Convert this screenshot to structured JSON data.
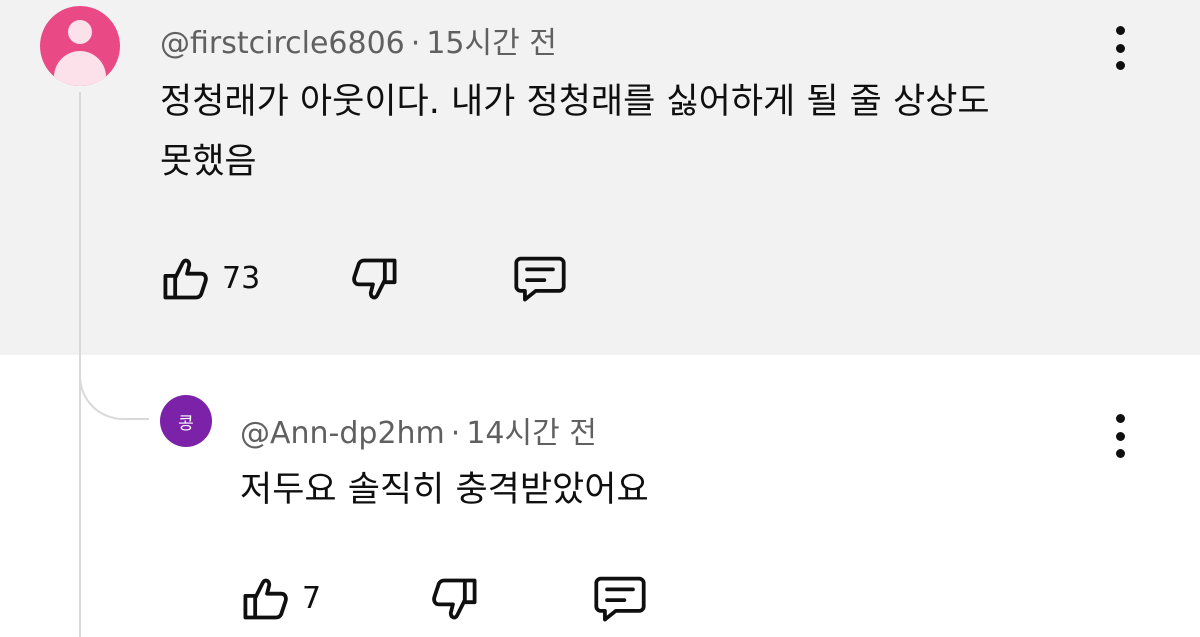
{
  "comment": {
    "handle": "@firstcircle6806",
    "time": "15시간 전",
    "text_line1": "정청래가 아웃이다. 내가 정청래를 싫어하게 될 줄 상상도",
    "text_line2": "못했음",
    "likes": "73",
    "avatar_color": "#e94a86"
  },
  "reply": {
    "handle": "@Ann-dp2hm",
    "time": "14시간 전",
    "avatar_text": "콩",
    "avatar_color": "#7b22a8",
    "text": "저두요 솔직히 충격받았어요",
    "likes": "7"
  },
  "separator": "·",
  "icons": [
    "like-icon",
    "dislike-icon",
    "reply-icon",
    "more-icon"
  ]
}
